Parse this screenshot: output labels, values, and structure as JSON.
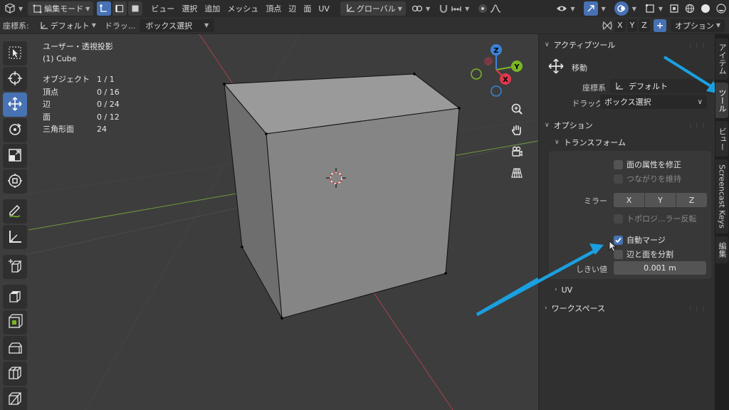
{
  "header": {
    "mode_dropdown": "編集モード",
    "menus": [
      "ビュー",
      "選択",
      "追加",
      "メッシュ",
      "頂点",
      "辺",
      "面",
      "UV"
    ],
    "orientation_dropdown": "グローバル"
  },
  "toolbar2": {
    "coord_label": "座標系:",
    "coord_value": "デフォルト",
    "drag_label": "ドラッ...",
    "drag_value": "ボックス選択",
    "axes": [
      "X",
      "Y",
      "Z"
    ],
    "options_label": "オプション"
  },
  "viewport": {
    "view_title": "ユーザー・透視投影",
    "object_name": "(1) Cube",
    "stats": [
      {
        "label": "オブジェクト",
        "value": "1 / 1"
      },
      {
        "label": "頂点",
        "value": "0 / 16"
      },
      {
        "label": "辺",
        "value": "0 / 24"
      },
      {
        "label": "面",
        "value": "0 / 12"
      },
      {
        "label": "三角形面",
        "value": "24"
      }
    ],
    "gizmo": {
      "z": "Z",
      "y": "Y",
      "x": "X"
    }
  },
  "sidebar": {
    "active_tool_header": "アクティブツール",
    "tool_name": "移動",
    "coord_label": "座標系",
    "coord_value": "デフォルト",
    "drag_label": "ドラッグ:",
    "drag_value": "ボックス選択",
    "options_header": "オプション",
    "transform_header": "トランスフォーム",
    "checks": {
      "face_attr": "面の属性を修正",
      "keep_connected": "つながりを維持",
      "topology_mirror": "トポロジ...ラー反転",
      "auto_merge": "自動マージ",
      "split_edges": "辺と面を分割"
    },
    "mirror_label": "ミラー",
    "mirror_axes": [
      "X",
      "Y",
      "Z"
    ],
    "threshold_label": "しきい値",
    "threshold_value": "0.001 m",
    "uv_header": "UV",
    "workspace_header": "ワークスペース"
  },
  "tabs": [
    "アイテム",
    "ツール",
    "ビュー",
    "Screencast Keys",
    "編集"
  ],
  "colors": {
    "accent": "#4772b3",
    "annotation_arrow": "#1aa0e0",
    "axis_x": "#e0384c",
    "axis_y": "#7bb526",
    "axis_z": "#3b83d8"
  }
}
